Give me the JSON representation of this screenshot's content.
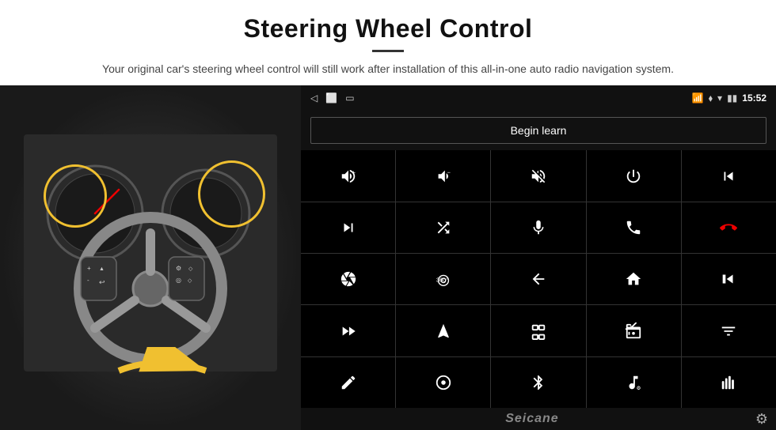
{
  "page": {
    "title": "Steering Wheel Control",
    "subtitle": "Your original car's steering wheel control will still work after installation of this all-in-one auto radio navigation system."
  },
  "status_bar": {
    "time": "15:52",
    "back_icon": "◁",
    "home_icon": "□",
    "recent_icon": "▭"
  },
  "begin_learn_button": "Begin learn",
  "controls": [
    {
      "icon": "vol_up",
      "label": "Volume Up",
      "unicode": "🔊+"
    },
    {
      "icon": "vol_down",
      "label": "Volume Down",
      "unicode": "🔉−"
    },
    {
      "icon": "mute",
      "label": "Mute",
      "unicode": "🔇"
    },
    {
      "icon": "power",
      "label": "Power",
      "unicode": "⏻"
    },
    {
      "icon": "prev_track_phone",
      "label": "Prev Track Phone",
      "unicode": "⏮"
    },
    {
      "icon": "next_track",
      "label": "Next Track",
      "unicode": "⏭"
    },
    {
      "icon": "shuffle",
      "label": "Shuffle",
      "unicode": "⤢⏭"
    },
    {
      "icon": "mic",
      "label": "Microphone",
      "unicode": "🎤"
    },
    {
      "icon": "phone",
      "label": "Phone",
      "unicode": "📞"
    },
    {
      "icon": "hang_up",
      "label": "Hang Up",
      "unicode": "📵"
    },
    {
      "icon": "camera",
      "label": "Camera",
      "unicode": "📷"
    },
    {
      "icon": "360",
      "label": "360 View",
      "unicode": "360"
    },
    {
      "icon": "back",
      "label": "Back",
      "unicode": "↺"
    },
    {
      "icon": "home",
      "label": "Home",
      "unicode": "⌂"
    },
    {
      "icon": "skip_back",
      "label": "Skip Back",
      "unicode": "⏮⏮"
    },
    {
      "icon": "fast_forward",
      "label": "Fast Forward",
      "unicode": "⏭⏭"
    },
    {
      "icon": "navigation",
      "label": "Navigation",
      "unicode": "➤"
    },
    {
      "icon": "eq",
      "label": "Equalizer",
      "unicode": "⇌"
    },
    {
      "icon": "radio",
      "label": "Radio",
      "unicode": "📻"
    },
    {
      "icon": "settings_eq",
      "label": "Settings EQ",
      "unicode": "⫰"
    },
    {
      "icon": "pen",
      "label": "Pen",
      "unicode": "✎"
    },
    {
      "icon": "circle_dot",
      "label": "Circle",
      "unicode": "⊙"
    },
    {
      "icon": "bluetooth",
      "label": "Bluetooth",
      "unicode": "⚡"
    },
    {
      "icon": "music",
      "label": "Music",
      "unicode": "🎵"
    },
    {
      "icon": "equalizer",
      "label": "Equalizer Bars",
      "unicode": "⏦"
    }
  ],
  "bottom": {
    "logo": "Seicane"
  }
}
